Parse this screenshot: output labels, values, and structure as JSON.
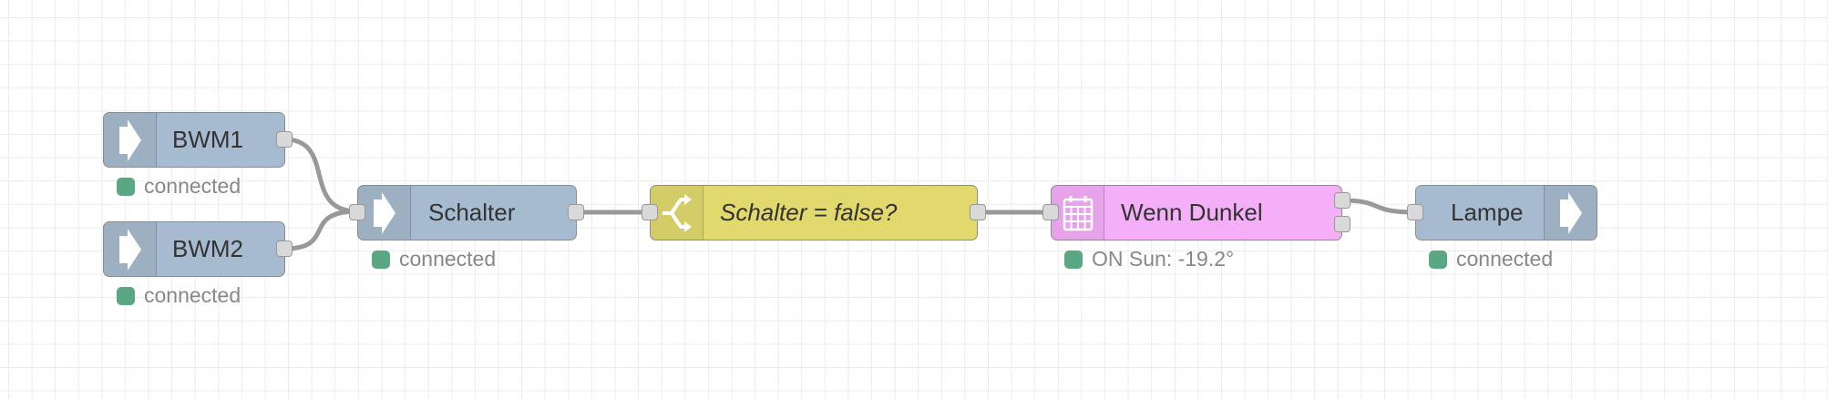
{
  "workspace": {
    "nodes": {
      "bwm1": {
        "label": "BWM1",
        "status": "connected",
        "icon": "arrow-right-icon",
        "color": "#a6bbcf"
      },
      "bwm2": {
        "label": "BWM2",
        "status": "connected",
        "icon": "arrow-right-icon",
        "color": "#a6bbcf"
      },
      "schalter": {
        "label": "Schalter",
        "status": "connected",
        "icon": "arrow-right-icon",
        "color": "#a6bbcf"
      },
      "switch": {
        "label": "Schalter = false?",
        "icon": "switch-branch-icon",
        "color": "#e2d96e"
      },
      "wenn_dunkel": {
        "label": "Wenn Dunkel",
        "status": "ON Sun: -19.2°",
        "icon": "calendar-icon",
        "color": "#f5aef8"
      },
      "lampe": {
        "label": "Lampe",
        "status": "connected",
        "icon": "arrow-right-icon",
        "color": "#a6bbcf"
      }
    },
    "status_color": "#5aa883",
    "wire_color": "#999999"
  }
}
